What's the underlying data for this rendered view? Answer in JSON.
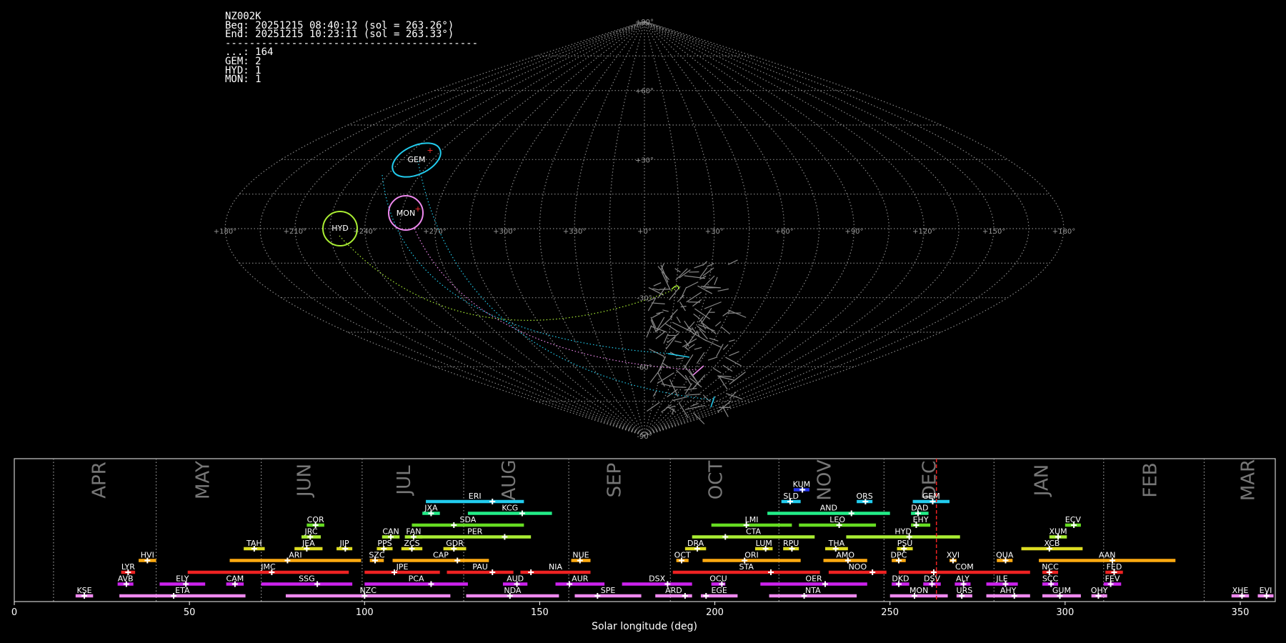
{
  "header": {
    "station": "NZ002K",
    "beg": "Beg: 20251215 08:40:12 (sol = 263.26°)",
    "end": "End: 20251215 10:23:11 (sol = 263.33°)",
    "separator": "------------------------------------------",
    "counts": [
      "...: 164",
      "GEM: 2",
      "HYD: 1",
      "MON: 1"
    ]
  },
  "sky_map": {
    "projection": "sinusoidal",
    "lon_labels": [
      "+180°",
      "+150°",
      "+120°",
      "+90°",
      "+60°",
      "+30°",
      "+0°",
      "+330°",
      "+300°",
      "+270°",
      "+240°",
      "+210°",
      "+180°"
    ],
    "lat_labels": [
      "+90°",
      "+60°",
      "+30°",
      "+0°",
      "-30°",
      "-60°",
      "-90°"
    ],
    "radiant_circles": [
      {
        "code": "GEM",
        "color": "#22ccee"
      },
      {
        "code": "MON",
        "color": "#ee88ee"
      },
      {
        "code": "HYD",
        "color": "#aaee33"
      }
    ]
  },
  "chart_data": {
    "type": "gantt",
    "xlabel": "Solar longitude (deg)",
    "xlim": [
      0,
      360
    ],
    "xticks": [
      0,
      50,
      100,
      150,
      200,
      250,
      300,
      350
    ],
    "current_sol": 263.26,
    "months": [
      {
        "label": "APR",
        "start": 11.2,
        "mid": 24.5
      },
      {
        "label": "MAY",
        "start": 40.5,
        "mid": 54.0
      },
      {
        "label": "JUN",
        "start": 70.5,
        "mid": 83.0
      },
      {
        "label": "JUL",
        "start": 99.3,
        "mid": 111.5
      },
      {
        "label": "AUG",
        "start": 128.3,
        "mid": 141.5
      },
      {
        "label": "SEP",
        "start": 158.3,
        "mid": 171.5
      },
      {
        "label": "OCT",
        "start": 187.3,
        "mid": 200.5
      },
      {
        "label": "NOV",
        "start": 218.3,
        "mid": 231.5
      },
      {
        "label": "DEC",
        "start": 248.3,
        "mid": 261.5
      },
      {
        "label": "JAN",
        "start": 279.7,
        "mid": 293.5
      },
      {
        "label": "FEB",
        "start": 311.0,
        "mid": 324.5
      },
      {
        "label": "MAR",
        "start": 339.7,
        "mid": 352.5
      }
    ],
    "showers": [
      {
        "code": "KUM",
        "start": 222.5,
        "end": 227.0,
        "peak": 225.0,
        "row": 9,
        "color": "#2233ee"
      },
      {
        "code": "ERI",
        "start": 117.5,
        "end": 145.5,
        "peak": 136.5,
        "row": 8,
        "color": "#22ccee"
      },
      {
        "code": "SLD",
        "start": 219.0,
        "end": 224.5,
        "peak": 221.5,
        "row": 8,
        "color": "#22ccee"
      },
      {
        "code": "ORS",
        "start": 240.5,
        "end": 245.0,
        "peak": 243.0,
        "row": 8,
        "color": "#22ccee"
      },
      {
        "code": "GEM",
        "start": 256.5,
        "end": 267.0,
        "peak": 262.2,
        "row": 8,
        "color": "#22ccee"
      },
      {
        "code": "JXA",
        "start": 116.5,
        "end": 121.5,
        "peak": 119.0,
        "row": 7,
        "color": "#22ee88"
      },
      {
        "code": "KCG",
        "start": 129.5,
        "end": 153.5,
        "peak": 145.0,
        "row": 7,
        "color": "#22ee88"
      },
      {
        "code": "AND",
        "start": 215.0,
        "end": 250.0,
        "peak": 239.0,
        "row": 7,
        "color": "#22ee88"
      },
      {
        "code": "DAD",
        "start": 256.0,
        "end": 261.0,
        "peak": 258.0,
        "row": 7,
        "color": "#22ee88"
      },
      {
        "code": "COR",
        "start": 83.5,
        "end": 88.5,
        "peak": 86.0,
        "row": 6,
        "color": "#66dd22"
      },
      {
        "code": "SDA",
        "start": 113.5,
        "end": 145.5,
        "peak": 125.5,
        "row": 6,
        "color": "#66dd22"
      },
      {
        "code": "LMI",
        "start": 199.0,
        "end": 222.0,
        "peak": 209.0,
        "row": 6,
        "color": "#66dd22"
      },
      {
        "code": "LEO",
        "start": 224.0,
        "end": 246.0,
        "peak": 235.5,
        "row": 6,
        "color": "#66dd22"
      },
      {
        "code": "EHY",
        "start": 256.0,
        "end": 261.5,
        "peak": 257.5,
        "row": 6,
        "color": "#66dd22"
      },
      {
        "code": "ECV",
        "start": 300.0,
        "end": 304.5,
        "peak": 302.5,
        "row": 6,
        "color": "#66dd22"
      },
      {
        "code": "JRC",
        "start": 82.0,
        "end": 87.5,
        "peak": 84.5,
        "row": 5,
        "color": "#aaee33"
      },
      {
        "code": "CAN",
        "start": 105.0,
        "end": 110.0,
        "peak": 107.5,
        "row": 5,
        "color": "#aaee33"
      },
      {
        "code": "FAN",
        "start": 111.5,
        "end": 116.5,
        "peak": 114.0,
        "row": 5,
        "color": "#aaee33"
      },
      {
        "code": "PER",
        "start": 115.5,
        "end": 147.5,
        "peak": 140.0,
        "row": 5,
        "color": "#aaee33"
      },
      {
        "code": "CTA",
        "start": 193.5,
        "end": 228.5,
        "peak": 203.0,
        "row": 5,
        "color": "#aaee33"
      },
      {
        "code": "HYD",
        "start": 237.5,
        "end": 270.0,
        "peak": 255.5,
        "row": 5,
        "color": "#aaee33"
      },
      {
        "code": "XUM",
        "start": 295.5,
        "end": 300.5,
        "peak": 298.0,
        "row": 5,
        "color": "#aaee33"
      },
      {
        "code": "TAH",
        "start": 65.5,
        "end": 71.5,
        "peak": 68.5,
        "row": 4,
        "color": "#dddd22"
      },
      {
        "code": "JEA",
        "start": 80.0,
        "end": 88.0,
        "peak": 83.5,
        "row": 4,
        "color": "#dddd22"
      },
      {
        "code": "JIP",
        "start": 92.0,
        "end": 96.5,
        "peak": 94.5,
        "row": 4,
        "color": "#dddd22"
      },
      {
        "code": "PPS",
        "start": 103.5,
        "end": 108.0,
        "peak": 105.5,
        "row": 4,
        "color": "#dddd22"
      },
      {
        "code": "ZCS",
        "start": 110.5,
        "end": 116.5,
        "peak": 113.5,
        "row": 4,
        "color": "#dddd22"
      },
      {
        "code": "GDR",
        "start": 122.5,
        "end": 129.0,
        "peak": 125.5,
        "row": 4,
        "color": "#dddd22"
      },
      {
        "code": "DRA",
        "start": 191.5,
        "end": 197.5,
        "peak": 195.0,
        "row": 4,
        "color": "#dddd22"
      },
      {
        "code": "LUM",
        "start": 211.5,
        "end": 216.5,
        "peak": 214.5,
        "row": 4,
        "color": "#dddd22"
      },
      {
        "code": "RPU",
        "start": 219.5,
        "end": 224.0,
        "peak": 222.0,
        "row": 4,
        "color": "#dddd22"
      },
      {
        "code": "THA",
        "start": 231.5,
        "end": 238.0,
        "peak": 234.5,
        "row": 4,
        "color": "#dddd22"
      },
      {
        "code": "PSU",
        "start": 252.0,
        "end": 256.5,
        "peak": 254.0,
        "row": 4,
        "color": "#dddd22"
      },
      {
        "code": "XCB",
        "start": 287.5,
        "end": 305.0,
        "peak": 295.5,
        "row": 4,
        "color": "#dddd22"
      },
      {
        "code": "HVI",
        "start": 35.5,
        "end": 40.5,
        "peak": 38.0,
        "row": 3,
        "color": "#ffaa11"
      },
      {
        "code": "ARI",
        "start": 61.5,
        "end": 99.0,
        "peak": 78.0,
        "row": 3,
        "color": "#ffaa11"
      },
      {
        "code": "SZC",
        "start": 101.5,
        "end": 105.5,
        "peak": 103.0,
        "row": 3,
        "color": "#ffaa11"
      },
      {
        "code": "CAP",
        "start": 108.0,
        "end": 135.5,
        "peak": 126.5,
        "row": 3,
        "color": "#ffaa11"
      },
      {
        "code": "NUE",
        "start": 159.0,
        "end": 164.5,
        "peak": 161.5,
        "row": 3,
        "color": "#ffaa11"
      },
      {
        "code": "OCT",
        "start": 189.0,
        "end": 192.5,
        "peak": 190.5,
        "row": 3,
        "color": "#ffaa11"
      },
      {
        "code": "ORI",
        "start": 196.5,
        "end": 224.5,
        "peak": 208.5,
        "row": 3,
        "color": "#ffaa11"
      },
      {
        "code": "AMO",
        "start": 231.0,
        "end": 243.5,
        "peak": 238.0,
        "row": 3,
        "color": "#ffaa11"
      },
      {
        "code": "DPC",
        "start": 250.5,
        "end": 254.5,
        "peak": 252.5,
        "row": 3,
        "color": "#ffaa11"
      },
      {
        "code": "XVI",
        "start": 267.0,
        "end": 269.0,
        "peak": 268.0,
        "row": 3,
        "color": "#ffaa11"
      },
      {
        "code": "QUA",
        "start": 280.5,
        "end": 285.0,
        "peak": 283.0,
        "row": 3,
        "color": "#ffaa11"
      },
      {
        "code": "AAN",
        "start": 292.5,
        "end": 331.5,
        "peak": 313.5,
        "row": 3,
        "color": "#ffaa11"
      },
      {
        "code": "LYR",
        "start": 30.5,
        "end": 34.5,
        "peak": 32.5,
        "row": 2,
        "color": "#ee2222"
      },
      {
        "code": "JMC",
        "start": 49.5,
        "end": 95.5,
        "peak": 73.5,
        "row": 2,
        "color": "#ee2222"
      },
      {
        "code": "JPE",
        "start": 100.0,
        "end": 121.5,
        "peak": 108.5,
        "row": 2,
        "color": "#ee2222"
      },
      {
        "code": "PAU",
        "start": 123.5,
        "end": 142.5,
        "peak": 136.5,
        "row": 2,
        "color": "#ee2222"
      },
      {
        "code": "NIA",
        "start": 144.5,
        "end": 164.5,
        "peak": 147.5,
        "row": 2,
        "color": "#ee2222"
      },
      {
        "code": "STA",
        "start": 188.0,
        "end": 230.0,
        "peak": 216.0,
        "row": 2,
        "color": "#ee2222"
      },
      {
        "code": "NOO",
        "start": 232.5,
        "end": 249.0,
        "peak": 245.0,
        "row": 2,
        "color": "#ee2222"
      },
      {
        "code": "COM",
        "start": 252.5,
        "end": 290.0,
        "peak": 262.5,
        "row": 2,
        "color": "#ee2222"
      },
      {
        "code": "NCC",
        "start": 293.5,
        "end": 298.0,
        "peak": 295.5,
        "row": 2,
        "color": "#ee2222"
      },
      {
        "code": "FED",
        "start": 311.5,
        "end": 316.5,
        "peak": 314.0,
        "row": 2,
        "color": "#ee2222"
      },
      {
        "code": "AVB",
        "start": 29.5,
        "end": 34.0,
        "peak": 32.0,
        "row": 1,
        "color": "#cc22ee"
      },
      {
        "code": "ELY",
        "start": 41.5,
        "end": 54.5,
        "peak": 49.0,
        "row": 1,
        "color": "#cc22ee"
      },
      {
        "code": "CAM",
        "start": 60.5,
        "end": 65.5,
        "peak": 63.0,
        "row": 1,
        "color": "#cc22ee"
      },
      {
        "code": "SSG",
        "start": 70.5,
        "end": 96.5,
        "peak": 86.5,
        "row": 1,
        "color": "#cc22ee"
      },
      {
        "code": "PCA",
        "start": 100.0,
        "end": 129.5,
        "peak": 119.0,
        "row": 1,
        "color": "#cc22ee"
      },
      {
        "code": "AUD",
        "start": 139.5,
        "end": 146.5,
        "peak": 143.5,
        "row": 1,
        "color": "#cc22ee"
      },
      {
        "code": "AUR",
        "start": 154.5,
        "end": 168.5,
        "peak": 158.5,
        "row": 1,
        "color": "#cc22ee"
      },
      {
        "code": "DSX",
        "start": 173.5,
        "end": 193.5,
        "peak": 186.5,
        "row": 1,
        "color": "#cc22ee"
      },
      {
        "code": "OCU",
        "start": 199.0,
        "end": 203.0,
        "peak": 202.0,
        "row": 1,
        "color": "#cc22ee"
      },
      {
        "code": "OER",
        "start": 213.0,
        "end": 243.5,
        "peak": 231.5,
        "row": 1,
        "color": "#cc22ee"
      },
      {
        "code": "DKD",
        "start": 250.5,
        "end": 255.5,
        "peak": 252.5,
        "row": 1,
        "color": "#cc22ee"
      },
      {
        "code": "DSV",
        "start": 259.5,
        "end": 264.5,
        "peak": 262.0,
        "row": 1,
        "color": "#cc22ee"
      },
      {
        "code": "ALY",
        "start": 268.5,
        "end": 273.0,
        "peak": 271.0,
        "row": 1,
        "color": "#cc22ee"
      },
      {
        "code": "JLE",
        "start": 277.5,
        "end": 286.5,
        "peak": 283.0,
        "row": 1,
        "color": "#cc22ee"
      },
      {
        "code": "SCC",
        "start": 293.5,
        "end": 298.0,
        "peak": 296.0,
        "row": 1,
        "color": "#cc22ee"
      },
      {
        "code": "FEV",
        "start": 311.0,
        "end": 316.0,
        "peak": 313.0,
        "row": 1,
        "color": "#cc22ee"
      },
      {
        "code": "KSE",
        "start": 17.5,
        "end": 22.5,
        "peak": 20.0,
        "row": 0,
        "color": "#ee88ee"
      },
      {
        "code": "ETA",
        "start": 30.0,
        "end": 66.0,
        "peak": 45.5,
        "row": 0,
        "color": "#ee88ee"
      },
      {
        "code": "NZC",
        "start": 77.5,
        "end": 124.5,
        "peak": 100.0,
        "row": 0,
        "color": "#ee88ee"
      },
      {
        "code": "NDA",
        "start": 129.0,
        "end": 155.5,
        "peak": 141.5,
        "row": 0,
        "color": "#ee88ee"
      },
      {
        "code": "SPE",
        "start": 160.0,
        "end": 179.0,
        "peak": 166.5,
        "row": 0,
        "color": "#ee88ee"
      },
      {
        "code": "ARD",
        "start": 183.0,
        "end": 193.5,
        "peak": 191.5,
        "row": 0,
        "color": "#ee88ee"
      },
      {
        "code": "EGE",
        "start": 196.0,
        "end": 206.5,
        "peak": 197.5,
        "row": 0,
        "color": "#ee88ee"
      },
      {
        "code": "NTA",
        "start": 215.5,
        "end": 240.5,
        "peak": 225.5,
        "row": 0,
        "color": "#ee88ee"
      },
      {
        "code": "MON",
        "start": 250.0,
        "end": 266.5,
        "peak": 257.0,
        "row": 0,
        "color": "#ee88ee"
      },
      {
        "code": "URS",
        "start": 269.0,
        "end": 273.5,
        "peak": 270.5,
        "row": 0,
        "color": "#ee88ee"
      },
      {
        "code": "AHY",
        "start": 277.5,
        "end": 290.0,
        "peak": 285.5,
        "row": 0,
        "color": "#ee88ee"
      },
      {
        "code": "GUM",
        "start": 293.5,
        "end": 304.5,
        "peak": 298.5,
        "row": 0,
        "color": "#ee88ee"
      },
      {
        "code": "OHY",
        "start": 307.5,
        "end": 312.0,
        "peak": 309.5,
        "row": 0,
        "color": "#ee88ee"
      },
      {
        "code": "XHE",
        "start": 347.5,
        "end": 352.5,
        "peak": 350.5,
        "row": 0,
        "color": "#ee88ee"
      },
      {
        "code": "EVI",
        "start": 355.0,
        "end": 359.5,
        "peak": 357.5,
        "row": 0,
        "color": "#ee88ee"
      }
    ]
  }
}
